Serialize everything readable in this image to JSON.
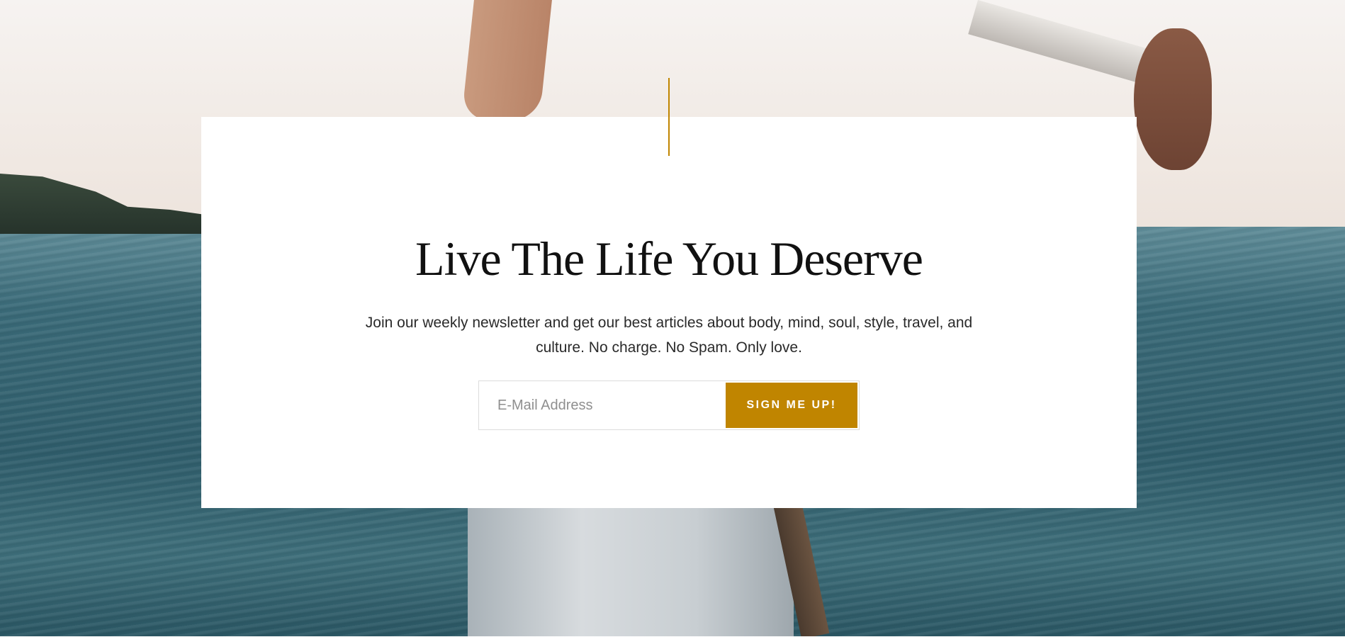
{
  "newsletter": {
    "headline": "Live The Life You Deserve",
    "description": "Join our weekly newsletter and get our best articles about body, mind, soul, style, travel, and culture. No charge. No Spam. Only love.",
    "email_placeholder": "E-Mail Address",
    "email_value": "",
    "submit_label": "SIGN ME UP!"
  },
  "colors": {
    "accent": "#c08500",
    "card_background": "#ffffff",
    "headline_text": "#111111",
    "body_text": "#2a2a2a"
  }
}
